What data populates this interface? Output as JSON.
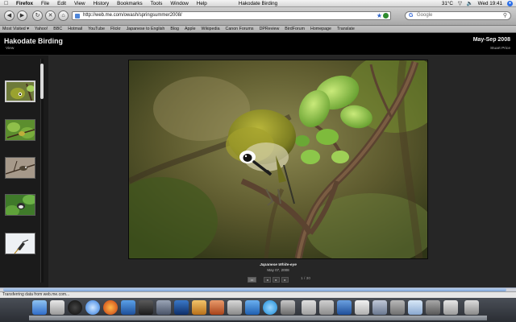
{
  "menubar": {
    "app_name": "Firefox",
    "menus": [
      "File",
      "Edit",
      "View",
      "History",
      "Bookmarks",
      "Tools",
      "Window",
      "Help"
    ],
    "window_title": "Hakodate Birding",
    "temperature": "31°C",
    "clock": "Wed 19:41"
  },
  "toolbar": {
    "url": "http://web.me.com/owash/springsummer2008/",
    "search_placeholder": "Google",
    "search_engine_glyph": "G"
  },
  "bookmarks": [
    "Most Visited ▾",
    "Yahoo!",
    "BBC",
    "Hotmail",
    "YouTube",
    "Flickr",
    "Japanese to English",
    "Blog",
    "Apple",
    "Wikipedia",
    "Canon Forums",
    "DPReview",
    "BirdForum",
    "Homepage",
    "Translate"
  ],
  "gallery": {
    "title": "Hakodate Birding",
    "view_link": "View",
    "date_range": "May-Sep 2008",
    "owner": "Stuart Price",
    "caption_title": "Japanese White-eye",
    "caption_date": "May 07, 2008",
    "counter": "1 / 30",
    "controls": {
      "grid": "▭",
      "prev": "◂",
      "play": "▸",
      "next": "▸"
    }
  },
  "status": {
    "text": "Transferring data from web.me.com..."
  },
  "colors": {
    "page_background": "#000000",
    "photo_panel": "#262626",
    "filmstrip": "#1b1b1b"
  }
}
